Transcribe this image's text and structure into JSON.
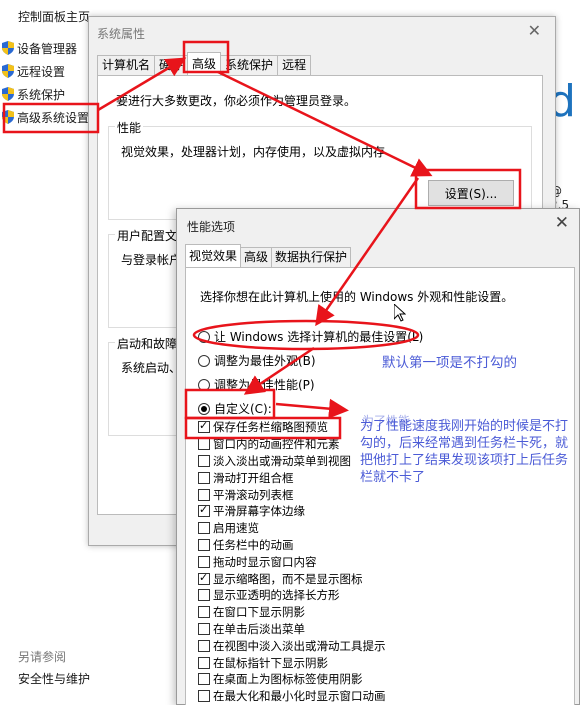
{
  "left_panel": {
    "home": "控制面板主页",
    "items": [
      {
        "label": "设备管理器",
        "icon": "shield-icon"
      },
      {
        "label": "远程设置",
        "icon": "shield-icon"
      },
      {
        "label": "系统保护",
        "icon": "shield-icon"
      },
      {
        "label": "高级系统设置",
        "icon": "shield-icon"
      }
    ],
    "also_see": "另请参阅",
    "security_link": "安全性与维护"
  },
  "background": {
    "big_letter": "d",
    "cpu_fragment": "@ 2.5"
  },
  "system_properties": {
    "title": "系统属性",
    "tabs": [
      "计算机名",
      "硬件",
      "高级",
      "系统保护",
      "远程"
    ],
    "active_tab": "高级",
    "admin_note": "要进行大多数更改，你必须作为管理员登录。",
    "performance_label": "性能",
    "performance_desc": "视觉效果，处理器计划，内存使用，以及虚拟内存",
    "settings_button": "设置(S)...",
    "user_profile_label": "用户配置文",
    "user_profile_desc": "与登录帐户",
    "startup_label": "启动和故障",
    "startup_desc": "系统启动、"
  },
  "performance_options": {
    "title": "性能选项",
    "tabs": [
      "视觉效果",
      "高级",
      "数据执行保护"
    ],
    "active_tab": "视觉效果",
    "choose_text": "选择你想在此计算机上使用的 Windows 外观和性能设置。",
    "radios": [
      {
        "label": "让 Windows 选择计算机的最佳设置(L)",
        "checked": false
      },
      {
        "label": "调整为最佳外观(B)",
        "checked": false
      },
      {
        "label": "调整为最佳性能(P)",
        "checked": false
      },
      {
        "label": "自定义(C):",
        "checked": true
      }
    ],
    "checkboxes": [
      {
        "label": "保存任务栏缩略图预览",
        "checked": true
      },
      {
        "label": "窗口内的动画控件和元素",
        "checked": false
      },
      {
        "label": "淡入淡出或滑动菜单到视图",
        "checked": false
      },
      {
        "label": "滑动打开组合框",
        "checked": false
      },
      {
        "label": "平滑滚动列表框",
        "checked": false
      },
      {
        "label": "平滑屏幕字体边缘",
        "checked": true
      },
      {
        "label": "启用速览",
        "checked": false
      },
      {
        "label": "任务栏中的动画",
        "checked": false
      },
      {
        "label": "拖动时显示窗口内容",
        "checked": false
      },
      {
        "label": "显示缩略图，而不是显示图标",
        "checked": true
      },
      {
        "label": "显示亚透明的选择长方形",
        "checked": false
      },
      {
        "label": "在窗口下显示阴影",
        "checked": false
      },
      {
        "label": "在单击后淡出菜单",
        "checked": false
      },
      {
        "label": "在视图中淡入淡出或滑动工具提示",
        "checked": false
      },
      {
        "label": "在鼠标指针下显示阴影",
        "checked": false
      },
      {
        "label": "在桌面上为图标标签使用阴影",
        "checked": false
      },
      {
        "label": "在最大化和最小化时显示窗口动画",
        "checked": false
      }
    ]
  },
  "annotations": {
    "default_note": "默认第一项是不打勾的",
    "reason_note": "为了性能速度我刚开始的时候是不打勾的，后来经常遇到任务栏卡死，就把他打上了结果发现该项打上后任务栏就不卡了",
    "ghost_text": "为了性能"
  },
  "colors": {
    "highlight_red": "#e8141b",
    "annotation_blue": "#4b5bd6"
  }
}
